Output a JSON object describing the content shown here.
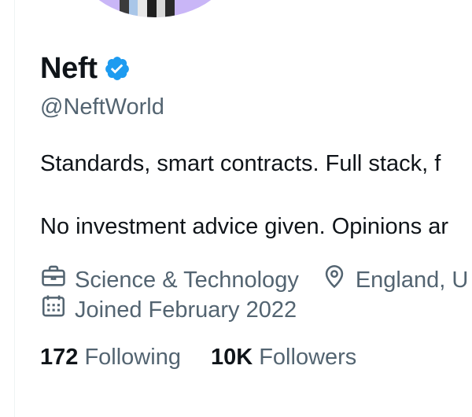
{
  "profile": {
    "display_name": "Neft",
    "handle": "@NeftWorld",
    "bio_line1": "Standards, smart contracts. Full stack, f",
    "bio_line2": "No investment advice given. Opinions ar",
    "category": "Science & Technology",
    "location": "England, U",
    "joined": "Joined February 2022",
    "following_count": "172",
    "following_label": "Following",
    "followers_count": "10K",
    "followers_label": "Followers"
  },
  "icons": {
    "verified": "verified-badge-icon",
    "category": "briefcase-icon",
    "location": "location-pin-icon",
    "joined": "calendar-icon"
  },
  "colors": {
    "verified_blue": "#1d9bf0",
    "secondary_text": "#536471",
    "avatar_bg": "#c9b6f7"
  }
}
